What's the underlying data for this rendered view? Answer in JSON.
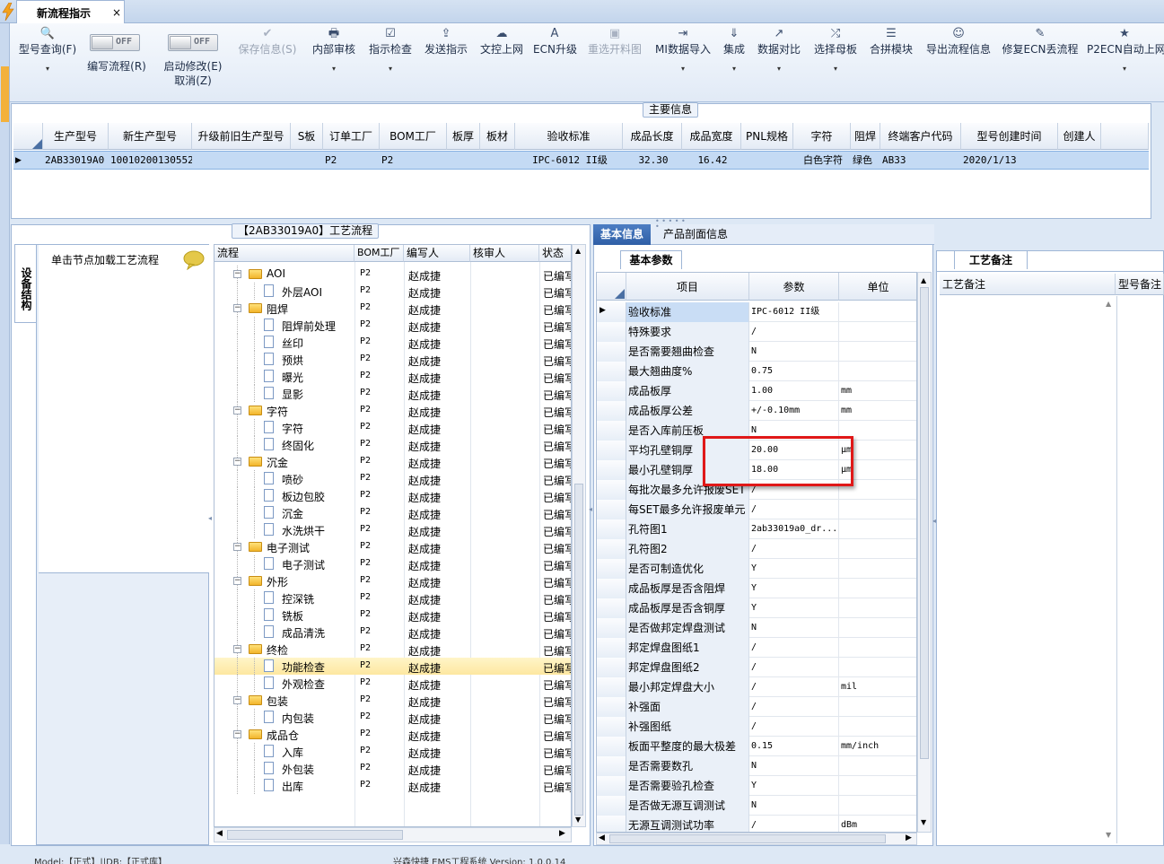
{
  "document_tab": {
    "title": "新流程指示",
    "close": "×"
  },
  "toolbar": {
    "items": [
      {
        "label": "型号查询(F)",
        "icon": "🔍"
      },
      {
        "label": "编写流程(R)",
        "toggle": "OFF"
      },
      {
        "label": "启动修改(E)",
        "label2": "取消(Z)",
        "toggle": "OFF"
      },
      {
        "label": "保存信息(S)",
        "icon": "✔"
      },
      {
        "label": "内部审核",
        "icon": "🖶"
      },
      {
        "label": "指示检查",
        "icon": "☑"
      },
      {
        "label": "发送指示",
        "icon": "⇪"
      },
      {
        "label": "文控上网",
        "icon": "☁"
      },
      {
        "label": "ECN升级",
        "icon": "A"
      },
      {
        "label": "重选开料图",
        "icon": "▣"
      },
      {
        "label": "MI数据导入",
        "icon": "⇥"
      },
      {
        "label": "集成",
        "icon": "⇓"
      },
      {
        "label": "数据对比",
        "icon": "↗"
      },
      {
        "label": "选择母板",
        "icon": "⤮"
      },
      {
        "label": "合拼模块",
        "icon": "☰"
      },
      {
        "label": "导出流程信息",
        "icon": "☺"
      },
      {
        "label": "修复ECN丢流程",
        "icon": "✎"
      },
      {
        "label": "P2ECN自动上网",
        "icon": "★"
      }
    ],
    "dropdown": "▾"
  },
  "main_info": {
    "title": "主要信息",
    "columns": [
      "生产型号",
      "新生产型号",
      "升级前旧生产型号",
      "S板",
      "订单工厂",
      "BOM工厂",
      "板厚",
      "板材",
      "验收标准",
      "成品长度",
      "成品宽度",
      "PNL规格",
      "字符",
      "阻焊",
      "终端客户代码",
      "型号创建时间",
      "创建人"
    ],
    "row": [
      "2AB33019A0",
      "10010200130552",
      "",
      "",
      "P2",
      "P2",
      "",
      "",
      "IPC-6012 II级",
      "32.30",
      "16.42",
      "",
      "白色字符",
      "绿色",
      "AB33",
      "2020/1/13",
      ""
    ]
  },
  "process_panel": {
    "title": "【2AB33019A0】工艺流程",
    "side_tab": "设备结构",
    "hint": "单击节点加载工艺流程",
    "columns": [
      "流程",
      "BOM工厂",
      "编写人",
      "核审人",
      "状态"
    ],
    "rows": [
      {
        "level": 1,
        "name": "AOI",
        "bom": "P2",
        "writer": "赵成捷",
        "reviewer": "",
        "status": "已编写"
      },
      {
        "level": 2,
        "name": "外层AOI",
        "bom": "P2",
        "writer": "赵成捷",
        "reviewer": "",
        "status": "已编写"
      },
      {
        "level": 1,
        "name": "阻焊",
        "bom": "P2",
        "writer": "赵成捷",
        "reviewer": "",
        "status": "已编写"
      },
      {
        "level": 2,
        "name": "阻焊前处理",
        "bom": "P2",
        "writer": "赵成捷",
        "reviewer": "",
        "status": "已编写"
      },
      {
        "level": 2,
        "name": "丝印",
        "bom": "P2",
        "writer": "赵成捷",
        "reviewer": "",
        "status": "已编写"
      },
      {
        "level": 2,
        "name": "预烘",
        "bom": "P2",
        "writer": "赵成捷",
        "reviewer": "",
        "status": "已编写"
      },
      {
        "level": 2,
        "name": "曝光",
        "bom": "P2",
        "writer": "赵成捷",
        "reviewer": "",
        "status": "已编写"
      },
      {
        "level": 2,
        "name": "显影",
        "bom": "P2",
        "writer": "赵成捷",
        "reviewer": "",
        "status": "已编写"
      },
      {
        "level": 1,
        "name": "字符",
        "bom": "P2",
        "writer": "赵成捷",
        "reviewer": "",
        "status": "已编写"
      },
      {
        "level": 2,
        "name": "字符",
        "bom": "P2",
        "writer": "赵成捷",
        "reviewer": "",
        "status": "已编写"
      },
      {
        "level": 2,
        "name": "终固化",
        "bom": "P2",
        "writer": "赵成捷",
        "reviewer": "",
        "status": "已编写"
      },
      {
        "level": 1,
        "name": "沉金",
        "bom": "P2",
        "writer": "赵成捷",
        "reviewer": "",
        "status": "已编写"
      },
      {
        "level": 2,
        "name": "喷砂",
        "bom": "P2",
        "writer": "赵成捷",
        "reviewer": "",
        "status": "已编写"
      },
      {
        "level": 2,
        "name": "板边包胶",
        "bom": "P2",
        "writer": "赵成捷",
        "reviewer": "",
        "status": "已编写"
      },
      {
        "level": 2,
        "name": "沉金",
        "bom": "P2",
        "writer": "赵成捷",
        "reviewer": "",
        "status": "已编写"
      },
      {
        "level": 2,
        "name": "水洗烘干",
        "bom": "P2",
        "writer": "赵成捷",
        "reviewer": "",
        "status": "已编写"
      },
      {
        "level": 1,
        "name": "电子测试",
        "bom": "P2",
        "writer": "赵成捷",
        "reviewer": "",
        "status": "已编写"
      },
      {
        "level": 2,
        "name": "电子测试",
        "bom": "P2",
        "writer": "赵成捷",
        "reviewer": "",
        "status": "已编写"
      },
      {
        "level": 1,
        "name": "外形",
        "bom": "P2",
        "writer": "赵成捷",
        "reviewer": "",
        "status": "已编写"
      },
      {
        "level": 2,
        "name": "控深铣",
        "bom": "P2",
        "writer": "赵成捷",
        "reviewer": "",
        "status": "已编写"
      },
      {
        "level": 2,
        "name": "铣板",
        "bom": "P2",
        "writer": "赵成捷",
        "reviewer": "",
        "status": "已编写"
      },
      {
        "level": 2,
        "name": "成品清洗",
        "bom": "P2",
        "writer": "赵成捷",
        "reviewer": "",
        "status": "已编写"
      },
      {
        "level": 1,
        "name": "终检",
        "bom": "P2",
        "writer": "赵成捷",
        "reviewer": "",
        "status": "已编写"
      },
      {
        "level": 2,
        "name": "功能检查",
        "bom": "P2",
        "writer": "赵成捷",
        "reviewer": "",
        "status": "已编写",
        "selected": true
      },
      {
        "level": 2,
        "name": "外观检查",
        "bom": "P2",
        "writer": "赵成捷",
        "reviewer": "",
        "status": "已编写"
      },
      {
        "level": 1,
        "name": "包装",
        "bom": "P2",
        "writer": "赵成捷",
        "reviewer": "",
        "status": "已编写"
      },
      {
        "level": 2,
        "name": "内包装",
        "bom": "P2",
        "writer": "赵成捷",
        "reviewer": "",
        "status": "已编写"
      },
      {
        "level": 1,
        "name": "成品仓",
        "bom": "P2",
        "writer": "赵成捷",
        "reviewer": "",
        "status": "已编写"
      },
      {
        "level": 2,
        "name": "入库",
        "bom": "P2",
        "writer": "赵成捷",
        "reviewer": "",
        "status": "已编写"
      },
      {
        "level": 2,
        "name": "外包装",
        "bom": "P2",
        "writer": "赵成捷",
        "reviewer": "",
        "status": "已编写"
      },
      {
        "level": 2,
        "name": "出库",
        "bom": "P2",
        "writer": "赵成捷",
        "reviewer": "",
        "status": "已编写"
      }
    ]
  },
  "info_panel": {
    "tabs": [
      "基本信息",
      "产品剖面信息"
    ],
    "subtab": "基本参数",
    "columns": [
      "项目",
      "参数",
      "单位"
    ],
    "rows": [
      {
        "k": "验收标准",
        "v": "IPC-6012 II级",
        "u": ""
      },
      {
        "k": "特殊要求",
        "v": "/",
        "u": ""
      },
      {
        "k": "是否需要翘曲检查",
        "v": "N",
        "u": ""
      },
      {
        "k": "最大翘曲度%",
        "v": "0.75",
        "u": ""
      },
      {
        "k": "成品板厚",
        "v": "1.00",
        "u": "mm"
      },
      {
        "k": "成品板厚公差",
        "v": "+/-0.10mm",
        "u": "mm"
      },
      {
        "k": "是否入库前压板",
        "v": "N",
        "u": ""
      },
      {
        "k": "平均孔壁铜厚",
        "v": "20.00",
        "u": "μm"
      },
      {
        "k": "最小孔壁铜厚",
        "v": "18.00",
        "u": "μm"
      },
      {
        "k": "每批次最多允许报废SET",
        "v": "/",
        "u": ""
      },
      {
        "k": "每SET最多允许报废单元",
        "v": "/",
        "u": ""
      },
      {
        "k": "孔符图1",
        "v": "2ab33019a0_dr...",
        "u": ""
      },
      {
        "k": "孔符图2",
        "v": "/",
        "u": ""
      },
      {
        "k": "是否可制造优化",
        "v": "Y",
        "u": ""
      },
      {
        "k": "成品板厚是否含阻焊",
        "v": "Y",
        "u": ""
      },
      {
        "k": "成品板厚是否含铜厚",
        "v": "Y",
        "u": ""
      },
      {
        "k": "是否做邦定焊盘测试",
        "v": "N",
        "u": ""
      },
      {
        "k": "邦定焊盘图纸1",
        "v": "/",
        "u": ""
      },
      {
        "k": "邦定焊盘图纸2",
        "v": "/",
        "u": ""
      },
      {
        "k": "最小邦定焊盘大小",
        "v": "/",
        "u": "mil"
      },
      {
        "k": "补强面",
        "v": "/",
        "u": ""
      },
      {
        "k": "补强图纸",
        "v": "/",
        "u": ""
      },
      {
        "k": "板面平整度的最大极差",
        "v": "0.15",
        "u": "mm/inch"
      },
      {
        "k": "是否需要数孔",
        "v": "N",
        "u": ""
      },
      {
        "k": "是否需要验孔检查",
        "v": "Y",
        "u": ""
      },
      {
        "k": "是否做无源互调测试",
        "v": "N",
        "u": ""
      },
      {
        "k": "无源互调测试功率",
        "v": "/",
        "u": "dBm"
      }
    ]
  },
  "notes_panel": {
    "tab": "工艺备注",
    "columns": [
      "工艺备注",
      "型号备注"
    ]
  },
  "status_bar": {
    "left": "Model:【正式】||DB:【正式库】",
    "center": "兴森快捷 EMS工程系统 Version: 1.0.0.14"
  }
}
